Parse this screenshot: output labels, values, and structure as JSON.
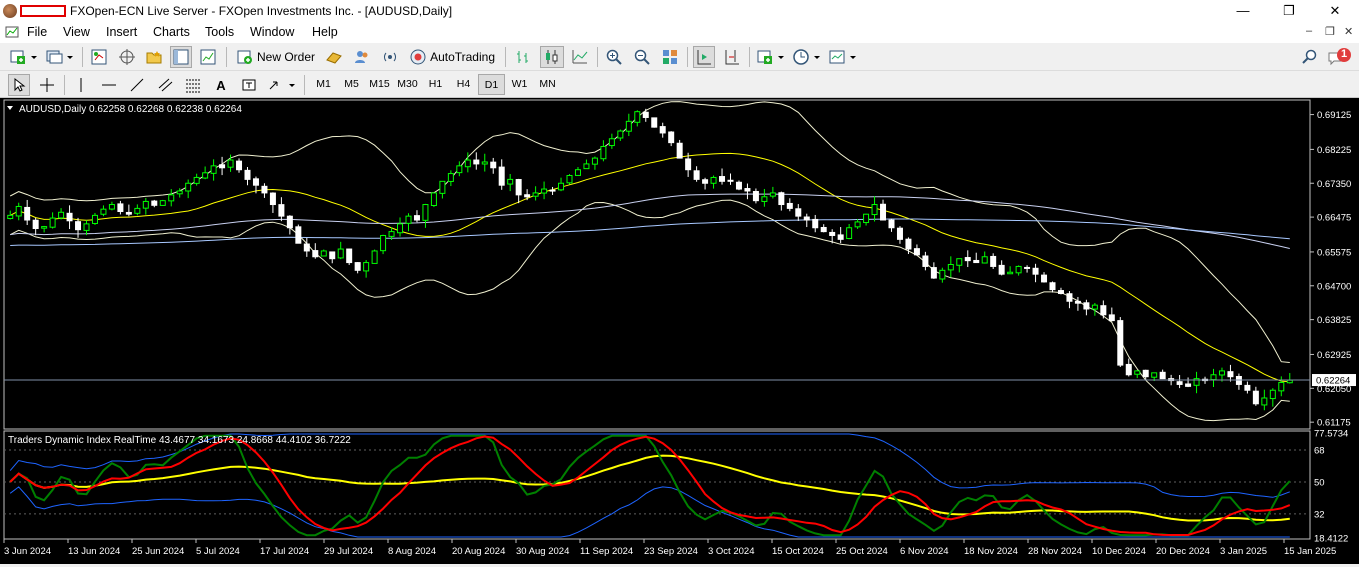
{
  "window": {
    "title": "FXOpen-ECN Live Server - FXOpen Investments Inc. - [AUDUSD,Daily]",
    "minimize": "—",
    "maximize": "❐",
    "close": "✕"
  },
  "menu": {
    "items": [
      "File",
      "View",
      "Insert",
      "Charts",
      "Tools",
      "Window",
      "Help"
    ],
    "mdi_minimize": "–",
    "mdi_restore": "❐",
    "mdi_close": "✕"
  },
  "toolbar": {
    "new_order_label": "New Order",
    "autotrading_label": "AutoTrading",
    "alert_count": "1",
    "line_tools": [
      "A"
    ],
    "timeframes": [
      "M1",
      "M5",
      "M15",
      "M30",
      "H1",
      "H4",
      "D1",
      "W1",
      "MN"
    ],
    "active_timeframe": "D1"
  },
  "chart": {
    "symbol_header": "AUDUSD,Daily  0.62258 0.62268 0.62238 0.62264",
    "price_labels": [
      "0.69125",
      "0.68225",
      "0.67350",
      "0.66475",
      "0.65575",
      "0.64700",
      "0.63825",
      "0.62925",
      "0.62050",
      "0.61175"
    ],
    "current_price": "0.62264",
    "colors": {
      "bull": "#00ff00",
      "bear": "#ffffff",
      "bollinger": "#ffff00",
      "tdi_price_line": "#008000",
      "tdi_signal": "#ff0000",
      "tdi_base": "#ffff00",
      "tdi_band": "#1e64ff"
    }
  },
  "indicator": {
    "header": "Traders Dynamic Index RealTime 43.4677 34.1673 24.8668 44.4102 36.7222",
    "levels": [
      "77.5734",
      "68",
      "50",
      "32",
      "18.4122"
    ]
  },
  "time_axis": {
    "labels": [
      "3 Jun 2024",
      "13 Jun 2024",
      "25 Jun 2024",
      "5 Jul 2024",
      "17 Jul 2024",
      "29 Jul 2024",
      "8 Aug 2024",
      "20 Aug 2024",
      "30 Aug 2024",
      "11 Sep 2024",
      "23 Sep 2024",
      "3 Oct 2024",
      "15 Oct 2024",
      "25 Oct 2024",
      "6 Nov 2024",
      "18 Nov 2024",
      "28 Nov 2024",
      "10 Dec 2024",
      "20 Dec 2024",
      "3 Jan 2025",
      "15 Jan 2025"
    ]
  },
  "chart_data": {
    "type": "candlestick",
    "title": "AUDUSD,Daily",
    "y_axis": {
      "min": 0.6105,
      "max": 0.6945,
      "ticks": [
        0.69125,
        0.68225,
        0.6735,
        0.66475,
        0.65575,
        0.647,
        0.63825,
        0.62925,
        0.6205,
        0.61175
      ]
    },
    "last_price": 0.62264,
    "closes": [
      0.6652,
      0.6675,
      0.664,
      0.6618,
      0.6623,
      0.6645,
      0.666,
      0.6638,
      0.6615,
      0.663,
      0.6652,
      0.6668,
      0.668,
      0.6662,
      0.6655,
      0.667,
      0.6688,
      0.6678,
      0.669,
      0.6705,
      0.6715,
      0.6735,
      0.675,
      0.6762,
      0.678,
      0.6775,
      0.6795,
      0.677,
      0.6745,
      0.673,
      0.671,
      0.668,
      0.665,
      0.662,
      0.658,
      0.656,
      0.6545,
      0.656,
      0.654,
      0.6565,
      0.653,
      0.651,
      0.653,
      0.656,
      0.66,
      0.661,
      0.663,
      0.665,
      0.664,
      0.668,
      0.671,
      0.674,
      0.676,
      0.678,
      0.6795,
      0.6785,
      0.679,
      0.6775,
      0.673,
      0.6745,
      0.6705,
      0.67,
      0.671,
      0.672,
      0.6715,
      0.6735,
      0.6755,
      0.677,
      0.6785,
      0.68,
      0.683,
      0.685,
      0.687,
      0.6895,
      0.692,
      0.6905,
      0.688,
      0.6865,
      0.684,
      0.68,
      0.677,
      0.6745,
      0.6735,
      0.675,
      0.674,
      0.674,
      0.672,
      0.6715,
      0.669,
      0.67,
      0.671,
      0.668,
      0.667,
      0.665,
      0.664,
      0.662,
      0.661,
      0.66,
      0.659,
      0.662,
      0.6635,
      0.6655,
      0.668,
      0.664,
      0.662,
      0.659,
      0.6565,
      0.655,
      0.652,
      0.649,
      0.651,
      0.6525,
      0.654,
      0.6535,
      0.653,
      0.6545,
      0.652,
      0.65,
      0.6505,
      0.652,
      0.6515,
      0.65,
      0.648,
      0.646,
      0.645,
      0.643,
      0.6425,
      0.641,
      0.642,
      0.6395,
      0.638,
      0.6265,
      0.624,
      0.625,
      0.6235,
      0.6245,
      0.623,
      0.6225,
      0.6215,
      0.621,
      0.623,
      0.6225,
      0.624,
      0.625,
      0.6235,
      0.6215,
      0.62,
      0.6165,
      0.618,
      0.62,
      0.622,
      0.6226
    ],
    "tdi": {
      "levels": [
        68,
        50,
        32
      ],
      "range": [
        18.4122,
        77.5734
      ],
      "values": [
        43.4677,
        34.1673,
        24.8668,
        44.4102,
        36.7222
      ]
    }
  }
}
